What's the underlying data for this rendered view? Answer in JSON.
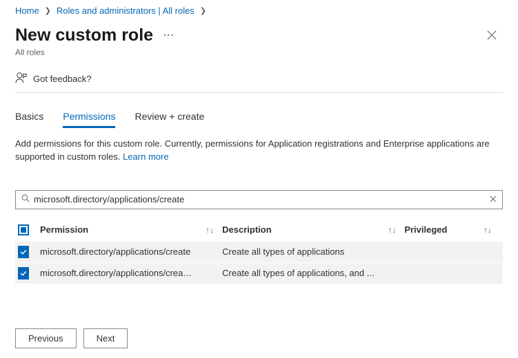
{
  "breadcrumb": {
    "home": "Home",
    "roles": "Roles and administrators | All roles"
  },
  "header": {
    "title": "New custom role",
    "subtitle": "All roles"
  },
  "feedback": {
    "label": "Got feedback?"
  },
  "tabs": {
    "basics": "Basics",
    "permissions": "Permissions",
    "review": "Review + create"
  },
  "description": {
    "text": "Add permissions for this custom role. Currently, permissions for Application registrations and Enterprise applications are supported in custom roles. ",
    "learn_more": "Learn more"
  },
  "search": {
    "value": "microsoft.directory/applications/create"
  },
  "table": {
    "headers": {
      "permission": "Permission",
      "description": "Description",
      "privileged": "Privileged"
    },
    "rows": [
      {
        "perm": "microsoft.directory/applications/create",
        "desc": "Create all types of applications"
      },
      {
        "perm": "microsoft.directory/applications/createAsOwner",
        "desc": "Create all types of applications, and ..."
      }
    ]
  },
  "buttons": {
    "previous": "Previous",
    "next": "Next"
  }
}
